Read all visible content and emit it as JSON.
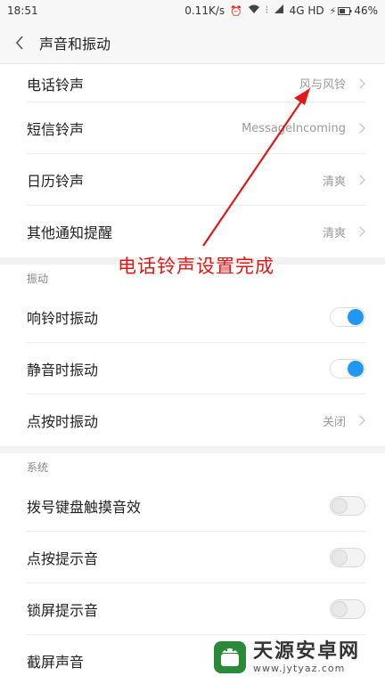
{
  "status_bar": {
    "time": "18:51",
    "speed": "0.11K/s",
    "network": "4G HD",
    "battery": "46%"
  },
  "header": {
    "title": "声音和振动"
  },
  "ringtones": [
    {
      "label": "电话铃声",
      "value": "风与风铃"
    },
    {
      "label": "短信铃声",
      "value": "MessageIncoming"
    },
    {
      "label": "日历铃声",
      "value": "清爽"
    },
    {
      "label": "其他通知提醒",
      "value": "清爽"
    }
  ],
  "vibration": {
    "section_title": "振动",
    "items": [
      {
        "label": "响铃时振动",
        "state": "on"
      },
      {
        "label": "静音时振动",
        "state": "on"
      },
      {
        "label": "点按时振动",
        "value": "关闭"
      }
    ]
  },
  "system": {
    "section_title": "系统",
    "items": [
      {
        "label": "拨号键盘触摸音效",
        "state": "off"
      },
      {
        "label": "点按提示音",
        "state": "off"
      },
      {
        "label": "锁屏提示音",
        "state": "off"
      },
      {
        "label": "截屏声音"
      }
    ]
  },
  "annotation": {
    "text": "电话铃声设置完成",
    "color": "#e01818"
  },
  "watermark": {
    "title": "天源安卓网",
    "url": "www.jytyaz.com"
  },
  "colors": {
    "accent": "#2196f3",
    "annotation": "#e01818"
  }
}
